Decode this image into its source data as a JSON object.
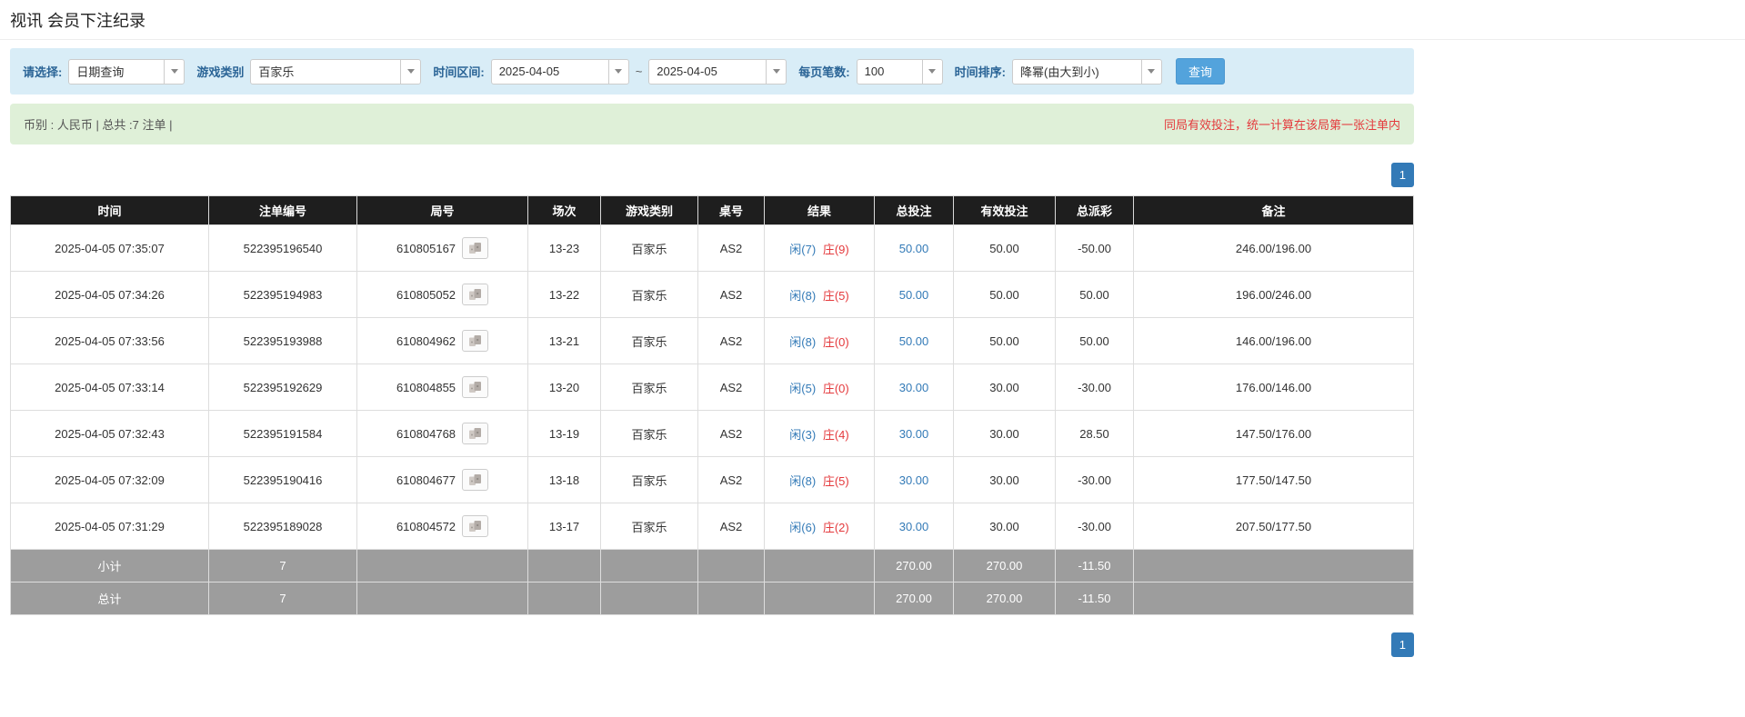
{
  "page": {
    "title": "视讯 会员下注纪录"
  },
  "filters": {
    "select_label": "请选择:",
    "select_value": "日期查询",
    "game_type_label": "游戏类别",
    "game_type_value": "百家乐",
    "time_range_label": "时间区间:",
    "date_from": "2025-04-05",
    "tilde": "~",
    "date_to": "2025-04-05",
    "per_page_label": "每页笔数:",
    "per_page_value": "100",
    "sort_label": "时间排序:",
    "sort_value": "降幂(由大到小)",
    "search_button": "查询"
  },
  "summary": {
    "left": "币别 : 人民币 | 总共 :7 注单 |",
    "right": "同局有效投注，统一计算在该局第一张注单内"
  },
  "pagination": {
    "page": "1"
  },
  "table": {
    "headers": [
      "时间",
      "注单编号",
      "局号",
      "场次",
      "游戏类别",
      "桌号",
      "结果",
      "总投注",
      "有效投注",
      "总派彩",
      "备注"
    ],
    "rows": [
      {
        "time": "2025-04-05 07:35:07",
        "bet_id": "522395196540",
        "round_id": "610805167",
        "session": "13-23",
        "game": "百家乐",
        "table_no": "AS2",
        "result_player": "闲(7)",
        "result_banker": "庄(9)",
        "total_bet": "50.00",
        "valid_bet": "50.00",
        "payout": "-50.00",
        "remark": "246.00/196.00"
      },
      {
        "time": "2025-04-05 07:34:26",
        "bet_id": "522395194983",
        "round_id": "610805052",
        "session": "13-22",
        "game": "百家乐",
        "table_no": "AS2",
        "result_player": "闲(8)",
        "result_banker": "庄(5)",
        "total_bet": "50.00",
        "valid_bet": "50.00",
        "payout": "50.00",
        "remark": "196.00/246.00"
      },
      {
        "time": "2025-04-05 07:33:56",
        "bet_id": "522395193988",
        "round_id": "610804962",
        "session": "13-21",
        "game": "百家乐",
        "table_no": "AS2",
        "result_player": "闲(8)",
        "result_banker": "庄(0)",
        "total_bet": "50.00",
        "valid_bet": "50.00",
        "payout": "50.00",
        "remark": "146.00/196.00"
      },
      {
        "time": "2025-04-05 07:33:14",
        "bet_id": "522395192629",
        "round_id": "610804855",
        "session": "13-20",
        "game": "百家乐",
        "table_no": "AS2",
        "result_player": "闲(5)",
        "result_banker": "庄(0)",
        "total_bet": "30.00",
        "valid_bet": "30.00",
        "payout": "-30.00",
        "remark": "176.00/146.00"
      },
      {
        "time": "2025-04-05 07:32:43",
        "bet_id": "522395191584",
        "round_id": "610804768",
        "session": "13-19",
        "game": "百家乐",
        "table_no": "AS2",
        "result_player": "闲(3)",
        "result_banker": "庄(4)",
        "total_bet": "30.00",
        "valid_bet": "30.00",
        "payout": "28.50",
        "remark": "147.50/176.00"
      },
      {
        "time": "2025-04-05 07:32:09",
        "bet_id": "522395190416",
        "round_id": "610804677",
        "session": "13-18",
        "game": "百家乐",
        "table_no": "AS2",
        "result_player": "闲(8)",
        "result_banker": "庄(5)",
        "total_bet": "30.00",
        "valid_bet": "30.00",
        "payout": "-30.00",
        "remark": "177.50/147.50"
      },
      {
        "time": "2025-04-05 07:31:29",
        "bet_id": "522395189028",
        "round_id": "610804572",
        "session": "13-17",
        "game": "百家乐",
        "table_no": "AS2",
        "result_player": "闲(6)",
        "result_banker": "庄(2)",
        "total_bet": "30.00",
        "valid_bet": "30.00",
        "payout": "-30.00",
        "remark": "207.50/177.50"
      }
    ],
    "subtotal": {
      "label": "小计",
      "count": "7",
      "total_bet": "270.00",
      "valid_bet": "270.00",
      "payout": "-11.50"
    },
    "total": {
      "label": "总计",
      "count": "7",
      "total_bet": "270.00",
      "valid_bet": "270.00",
      "payout": "-11.50"
    }
  }
}
